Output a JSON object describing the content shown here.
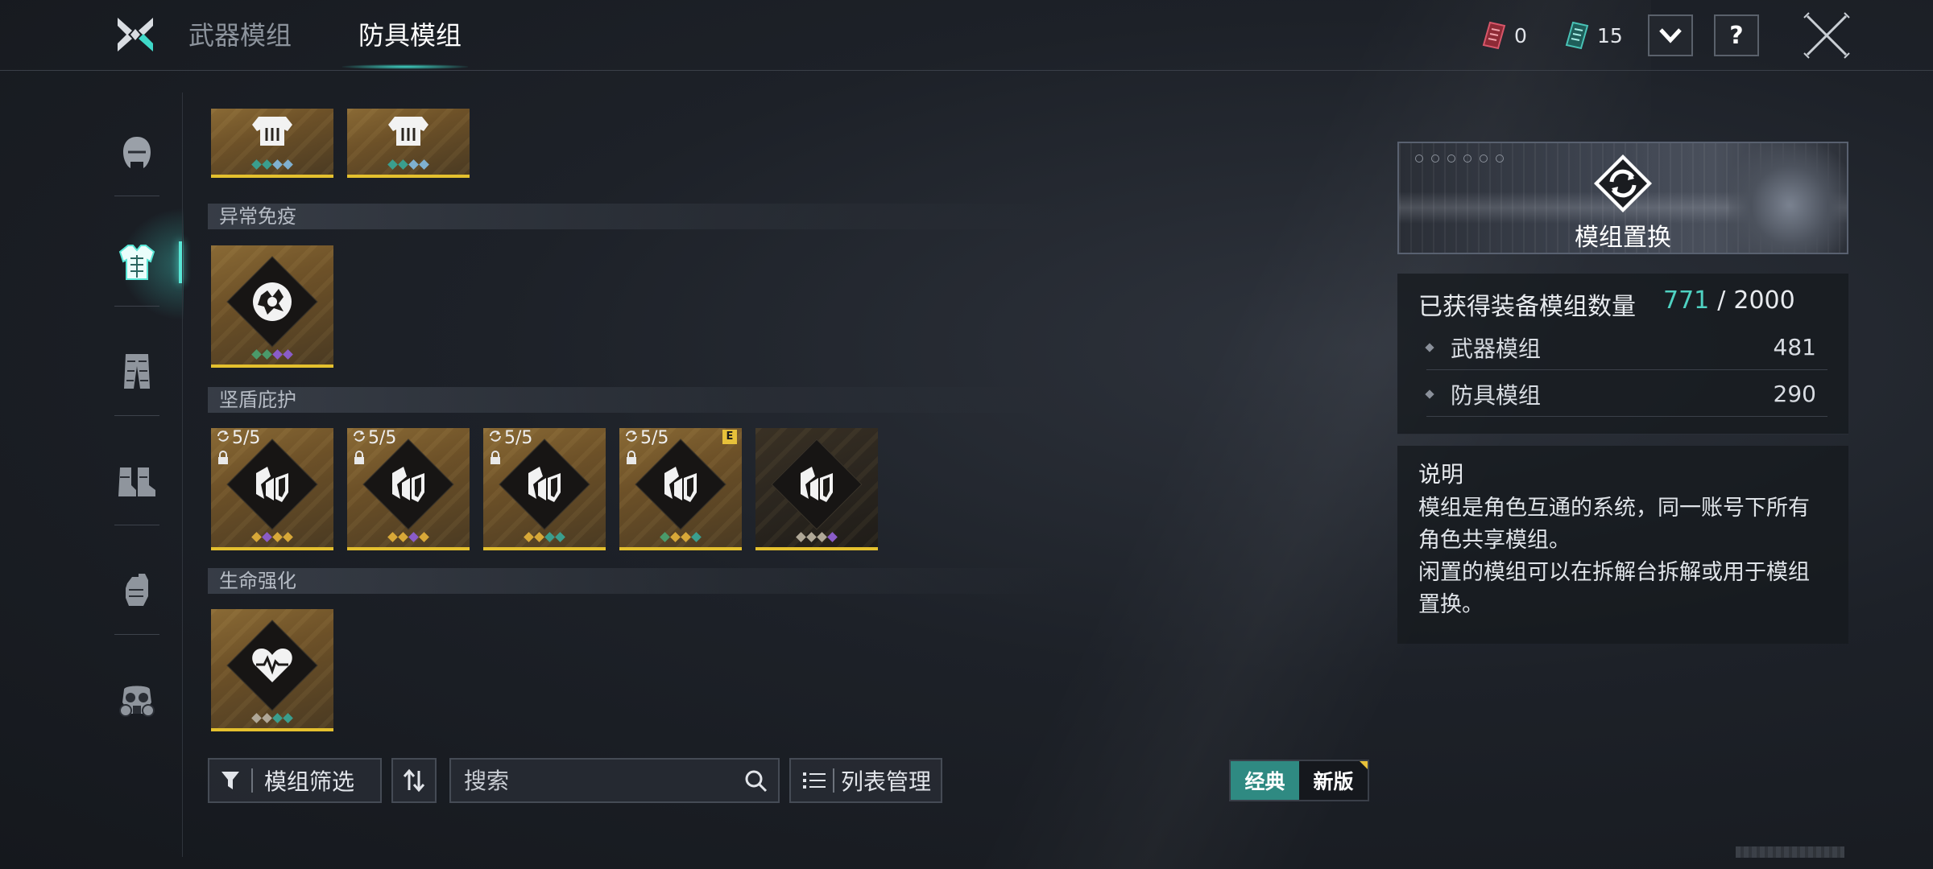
{
  "header": {
    "tabs": [
      {
        "label": "武器模组",
        "active": false
      },
      {
        "label": "防具模组",
        "active": true
      }
    ],
    "currencies": [
      {
        "icon": "red-ticket-icon",
        "value": "0",
        "color": "#c23a4a"
      },
      {
        "icon": "teal-ticket-icon",
        "value": "15",
        "color": "#3ab0a8"
      }
    ],
    "help_label": "?"
  },
  "sidebar": {
    "items": [
      {
        "name": "helmet",
        "icon": "helmet-icon",
        "active": false
      },
      {
        "name": "body-armor",
        "icon": "body-armor-icon",
        "active": true
      },
      {
        "name": "legs",
        "icon": "leg-armor-icon",
        "active": false
      },
      {
        "name": "boots",
        "icon": "boots-icon",
        "active": false
      },
      {
        "name": "gloves",
        "icon": "glove-icon",
        "active": false
      },
      {
        "name": "gas-mask",
        "icon": "gas-mask-icon",
        "active": false
      }
    ]
  },
  "grid": {
    "top_partial": [
      {
        "icon": "armor-vest-icon",
        "gems": [
          "#3a9e8e",
          "#3a9e8e",
          "#7fb0d0",
          "#7fb0d0"
        ]
      },
      {
        "icon": "armor-vest-icon",
        "gems": [
          "#3a9e8e",
          "#3a9e8e",
          "#7fb0d0",
          "#7fb0d0"
        ]
      }
    ],
    "sections": [
      {
        "title": "异常免疫",
        "cards": [
          {
            "icon": "anomaly-immunity-icon",
            "gems": [
              "#4a9a6a",
              "#4a9a6a",
              "#8a5cc8",
              "#8a5cc8"
            ],
            "count": "",
            "locked": false,
            "tag": "",
            "dark": false
          }
        ]
      },
      {
        "title": "坚盾庇护",
        "cards": [
          {
            "icon": "shield-shelter-icon",
            "gems": [
              "#d8a838",
              "#8a5cc8",
              "#d8a838",
              "#d8a838"
            ],
            "count": "5/5",
            "locked": true,
            "tag": "",
            "dark": false
          },
          {
            "icon": "shield-shelter-icon",
            "gems": [
              "#d8a838",
              "#d8a838",
              "#8a5cc8",
              "#d8a838"
            ],
            "count": "5/5",
            "locked": true,
            "tag": "",
            "dark": false
          },
          {
            "icon": "shield-shelter-icon",
            "gems": [
              "#d8a838",
              "#d8a838",
              "#3a9e8e",
              "#3a9e8e"
            ],
            "count": "5/5",
            "locked": true,
            "tag": "",
            "dark": false
          },
          {
            "icon": "shield-shelter-icon",
            "gems": [
              "#4a9a6a",
              "#d8a838",
              "#d8a838",
              "#3a9e8e"
            ],
            "count": "5/5",
            "locked": true,
            "tag": "E",
            "dark": false
          },
          {
            "icon": "shield-shelter-icon",
            "gems": [
              "#b0a898",
              "#b0a898",
              "#b0a898",
              "#8a5cc8"
            ],
            "count": "",
            "locked": false,
            "tag": "",
            "dark": true
          }
        ]
      },
      {
        "title": "生命强化",
        "cards": [
          {
            "icon": "heart-pulse-icon",
            "gems": [
              "#b0a898",
              "#b0a898",
              "#3a9e8e",
              "#3a9e8e"
            ],
            "count": "",
            "locked": false,
            "tag": "",
            "dark": false
          }
        ]
      }
    ]
  },
  "toolbar": {
    "filter_label": "模组筛选",
    "search_placeholder": "搜索",
    "list_label": "列表管理",
    "mode_classic": "经典",
    "mode_new": "新版"
  },
  "right_panel": {
    "banner_title": "模组置换",
    "stats": {
      "label": "已获得装备模组数量",
      "owned": "771",
      "slash": "/",
      "capacity": "2000",
      "rows": [
        {
          "label": "武器模组",
          "value": "481"
        },
        {
          "label": "防具模组",
          "value": "290"
        }
      ]
    },
    "description": {
      "title": "说明",
      "lines": [
        "模组是角色互通的系统，同一账号下所有角色共享模组。",
        "闲置的模组可以在拆解台拆解或用于模组置换。"
      ]
    }
  },
  "colors": {
    "accent_teal": "#4fd2c2",
    "card_border": "#e4c02e",
    "tag_yellow": "#e7c13a"
  }
}
